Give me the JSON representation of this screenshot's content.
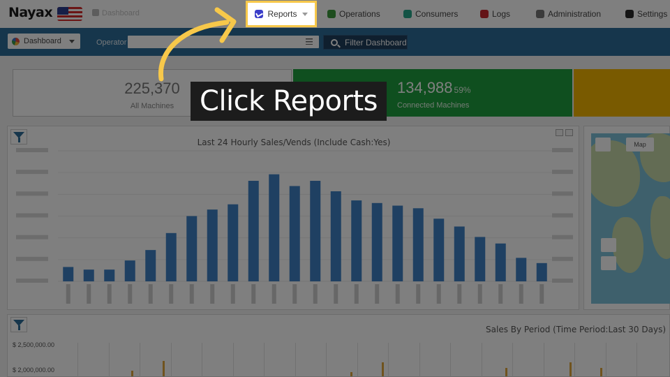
{
  "nav": {
    "logo": "Nayax",
    "breadcrumb": "Dashboard",
    "items": [
      {
        "label": "Reports",
        "icon": "reports-icon"
      },
      {
        "label": "Operations",
        "icon": "operations-icon"
      },
      {
        "label": "Consumers",
        "icon": "consumers-icon"
      },
      {
        "label": "Logs",
        "icon": "logs-icon"
      },
      {
        "label": "Administration",
        "icon": "administration-icon"
      },
      {
        "label": "Settings",
        "icon": "settings-icon"
      }
    ]
  },
  "toolbar": {
    "dashboard_select": "Dashboard",
    "operator_label": "Operator",
    "operator_value": "",
    "filter_button": "Filter Dashboard"
  },
  "kpis": {
    "all_machines": {
      "value": "225,370",
      "label": "All Machines"
    },
    "connected_machines": {
      "value": "134,988",
      "percent": "59%",
      "label": "Connected Machines"
    }
  },
  "hourly_chart": {
    "chart_data": {
      "type": "bar",
      "title": "Last 24 Hourly Sales/Vends (Include Cash:Yes)",
      "categories": [
        "1",
        "2",
        "3",
        "4",
        "5",
        "6",
        "7",
        "8",
        "9",
        "10",
        "11",
        "12",
        "13",
        "14",
        "15",
        "16",
        "17",
        "18",
        "19",
        "20",
        "21",
        "22",
        "23",
        "24"
      ],
      "series": [
        {
          "values": [
            0.11,
            0.09,
            0.09,
            0.16,
            0.24,
            0.37,
            0.5,
            0.55,
            0.59,
            0.77,
            0.82,
            0.73,
            0.77,
            0.69,
            0.62,
            0.6,
            0.58,
            0.56,
            0.48,
            0.42,
            0.34,
            0.29,
            0.18,
            0.14
          ]
        }
      ],
      "ylim": [
        0,
        1
      ],
      "grid": true
    }
  },
  "map": {
    "map_type": "Map"
  },
  "sales_chart": {
    "title": "Sales By Period (Time Period:Last 30 Days)",
    "yticks": [
      "$ 2,500,000.00",
      "$ 2,000,000.00"
    ]
  },
  "tutorial": {
    "callout": "Click Reports",
    "highlight_color": "#f7c84a"
  }
}
